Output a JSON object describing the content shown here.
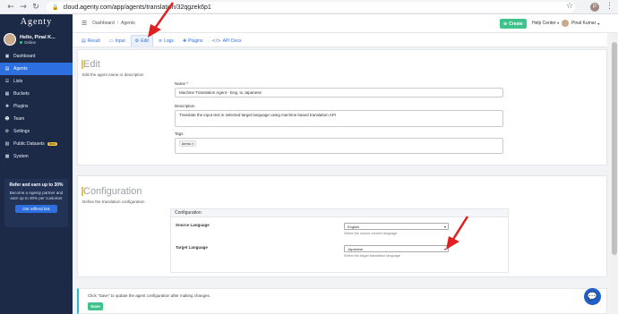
{
  "browser": {
    "url": "cloud.agenty.com/app/agents/translation/32qgzek6p1",
    "profile_initial": "P"
  },
  "sidebar": {
    "logo": "Agenty",
    "user_name": "Hello, Pinal K...",
    "user_status": "Online",
    "items": [
      {
        "label": "Dashboard",
        "icon": "dashboard-icon",
        "glyph": "▣"
      },
      {
        "label": "Agents",
        "icon": "agents-icon",
        "glyph": "▤"
      },
      {
        "label": "Lists",
        "icon": "lists-icon",
        "glyph": "☰"
      },
      {
        "label": "Buckets",
        "icon": "buckets-icon",
        "glyph": "▦"
      },
      {
        "label": "Plugins",
        "icon": "plugins-icon",
        "glyph": "✚"
      },
      {
        "label": "Team",
        "icon": "team-icon",
        "glyph": "☻"
      },
      {
        "label": "Settings",
        "icon": "settings-icon",
        "glyph": "⚙"
      },
      {
        "label": "Public Datasets",
        "icon": "datasets-icon",
        "glyph": "▧",
        "badge": "New"
      },
      {
        "label": "System",
        "icon": "system-icon",
        "glyph": "▩"
      }
    ],
    "promo": {
      "title": "Refer and earn up to 30%",
      "text": "Become a Agenty partner and earn up to 30% per customer",
      "button": "Get refferal link"
    }
  },
  "topbar": {
    "breadcrumb": [
      "Dashboard",
      "Agents"
    ],
    "create_label": "Create",
    "help_label": "Help Center",
    "user_label": "Pinal Kumar"
  },
  "tabs": [
    {
      "label": "Result",
      "icon": "result-icon",
      "glyph": "▤"
    },
    {
      "label": "Input",
      "icon": "input-icon",
      "glyph": "▭"
    },
    {
      "label": "Edit",
      "icon": "edit-icon",
      "glyph": "⚙",
      "active": true
    },
    {
      "label": "Logs",
      "icon": "logs-icon",
      "glyph": "≡"
    },
    {
      "label": "Plugins",
      "icon": "plugins-tab-icon",
      "glyph": "✚"
    },
    {
      "label": "API Docs",
      "icon": "code-icon",
      "glyph": "</>"
    }
  ],
  "edit": {
    "title": "Edit",
    "subtitle": "Edit the agent name or description",
    "name_label": "Name *",
    "name_value": "Machine Translation Agent - Eng. to Japanese",
    "description_label": "Description",
    "description_value": "Translate the input text in selected target language using machine based translation API",
    "tags_label": "Tags",
    "tag": "demo"
  },
  "configuration": {
    "title": "Configuration",
    "subtitle": "Define the translation configuration",
    "box_title": "Configuration",
    "source_label": "Source Language",
    "source_value": "English",
    "source_help": "Select the source content language",
    "target_label": "Target Language",
    "target_value": "Japanese",
    "target_help": "Select the target translation language"
  },
  "footer": {
    "text": "Click \"Save\" to update the agent configuration after making changes.",
    "save_label": "Save"
  },
  "colors": {
    "sidebar": "#1c2a48",
    "accent": "#2e6fe0",
    "success": "#3fc28b",
    "arrow": "#e02020"
  }
}
